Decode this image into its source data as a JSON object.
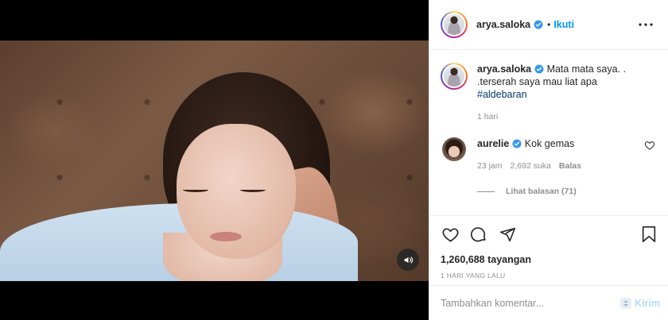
{
  "header": {
    "username": "arya.saloka",
    "separator": "•",
    "follow_label": "Ikuti"
  },
  "caption": {
    "username": "arya.saloka",
    "text_line1": "Mata mata saya. .",
    "text_line2": ".terserah saya mau liat apa",
    "hashtag": "#aldebaran",
    "time": "1 hari"
  },
  "comments": [
    {
      "username": "aurelie",
      "text": "Kok gemas",
      "time": "23 jam",
      "likes": "2,692 suka",
      "reply_label": "Balas",
      "view_replies": "Lihat balasan (71)"
    }
  ],
  "stats": {
    "views": "1,260,688 tayangan",
    "date_ago": "1 HARI YANG LALU"
  },
  "composer": {
    "placeholder": "Tambahkan komentar...",
    "post_label": "Kirim"
  },
  "icons": {
    "verified": "verified-badge-icon",
    "more": "more-options-icon",
    "like": "heart-icon",
    "comment": "comment-bubble-icon",
    "share": "paper-plane-icon",
    "save": "bookmark-icon",
    "sound": "speaker-icon"
  },
  "colors": {
    "accent": "#0095f6",
    "verified": "#3897f0",
    "muted": "#8e8e8e",
    "post_disabled": "#b3dbff"
  }
}
